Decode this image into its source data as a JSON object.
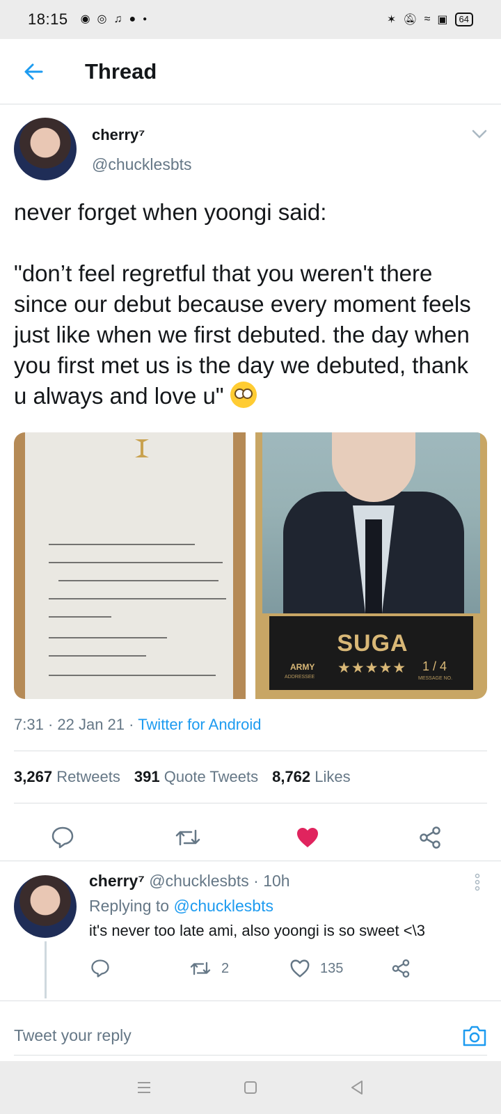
{
  "status_bar": {
    "time": "18:15",
    "notification_icons": [
      "discord-icon",
      "messenger-icon",
      "tiktok-icon",
      "reddit-icon",
      "dot-icon"
    ],
    "battery": "64"
  },
  "header": {
    "title": "Thread"
  },
  "tweet": {
    "author_name": "cherry⁷",
    "author_handle": "@chucklesbts",
    "text_line1": "never forget when yoongi said:",
    "text_quote": "\"don’t feel regretful that you weren't there since our debut because every moment feels just like when we first debuted. the day when you first met us is the day we debuted, thank u always and love u\"",
    "card": {
      "name": "SUGA",
      "army": "ARMY",
      "addressee": "ADDRESSEE",
      "stars": "★★★★★",
      "number": "1 / 4",
      "message_no": "MESSAGE NO."
    },
    "time": "7:31",
    "date": "22 Jan 21",
    "source": "Twitter for Android",
    "retweets_count": "3,267",
    "retweets_label": "Retweets",
    "quotes_count": "391",
    "quotes_label": "Quote Tweets",
    "likes_count": "8,762",
    "likes_label": "Likes",
    "liked": true,
    "like_color": "#e0245e"
  },
  "reply": {
    "author_name": "cherry⁷",
    "author_handle": "@chucklesbts",
    "age": "10h",
    "replying_prefix": "Replying to",
    "replying_to": "@chucklesbts",
    "text": "it's never too late ami, also yoongi is so sweet <\\3",
    "retweets": "2",
    "likes": "135"
  },
  "compose": {
    "placeholder": "Tweet your reply"
  },
  "colors": {
    "accent": "#1d9bf0",
    "secondary_text": "#657786"
  }
}
